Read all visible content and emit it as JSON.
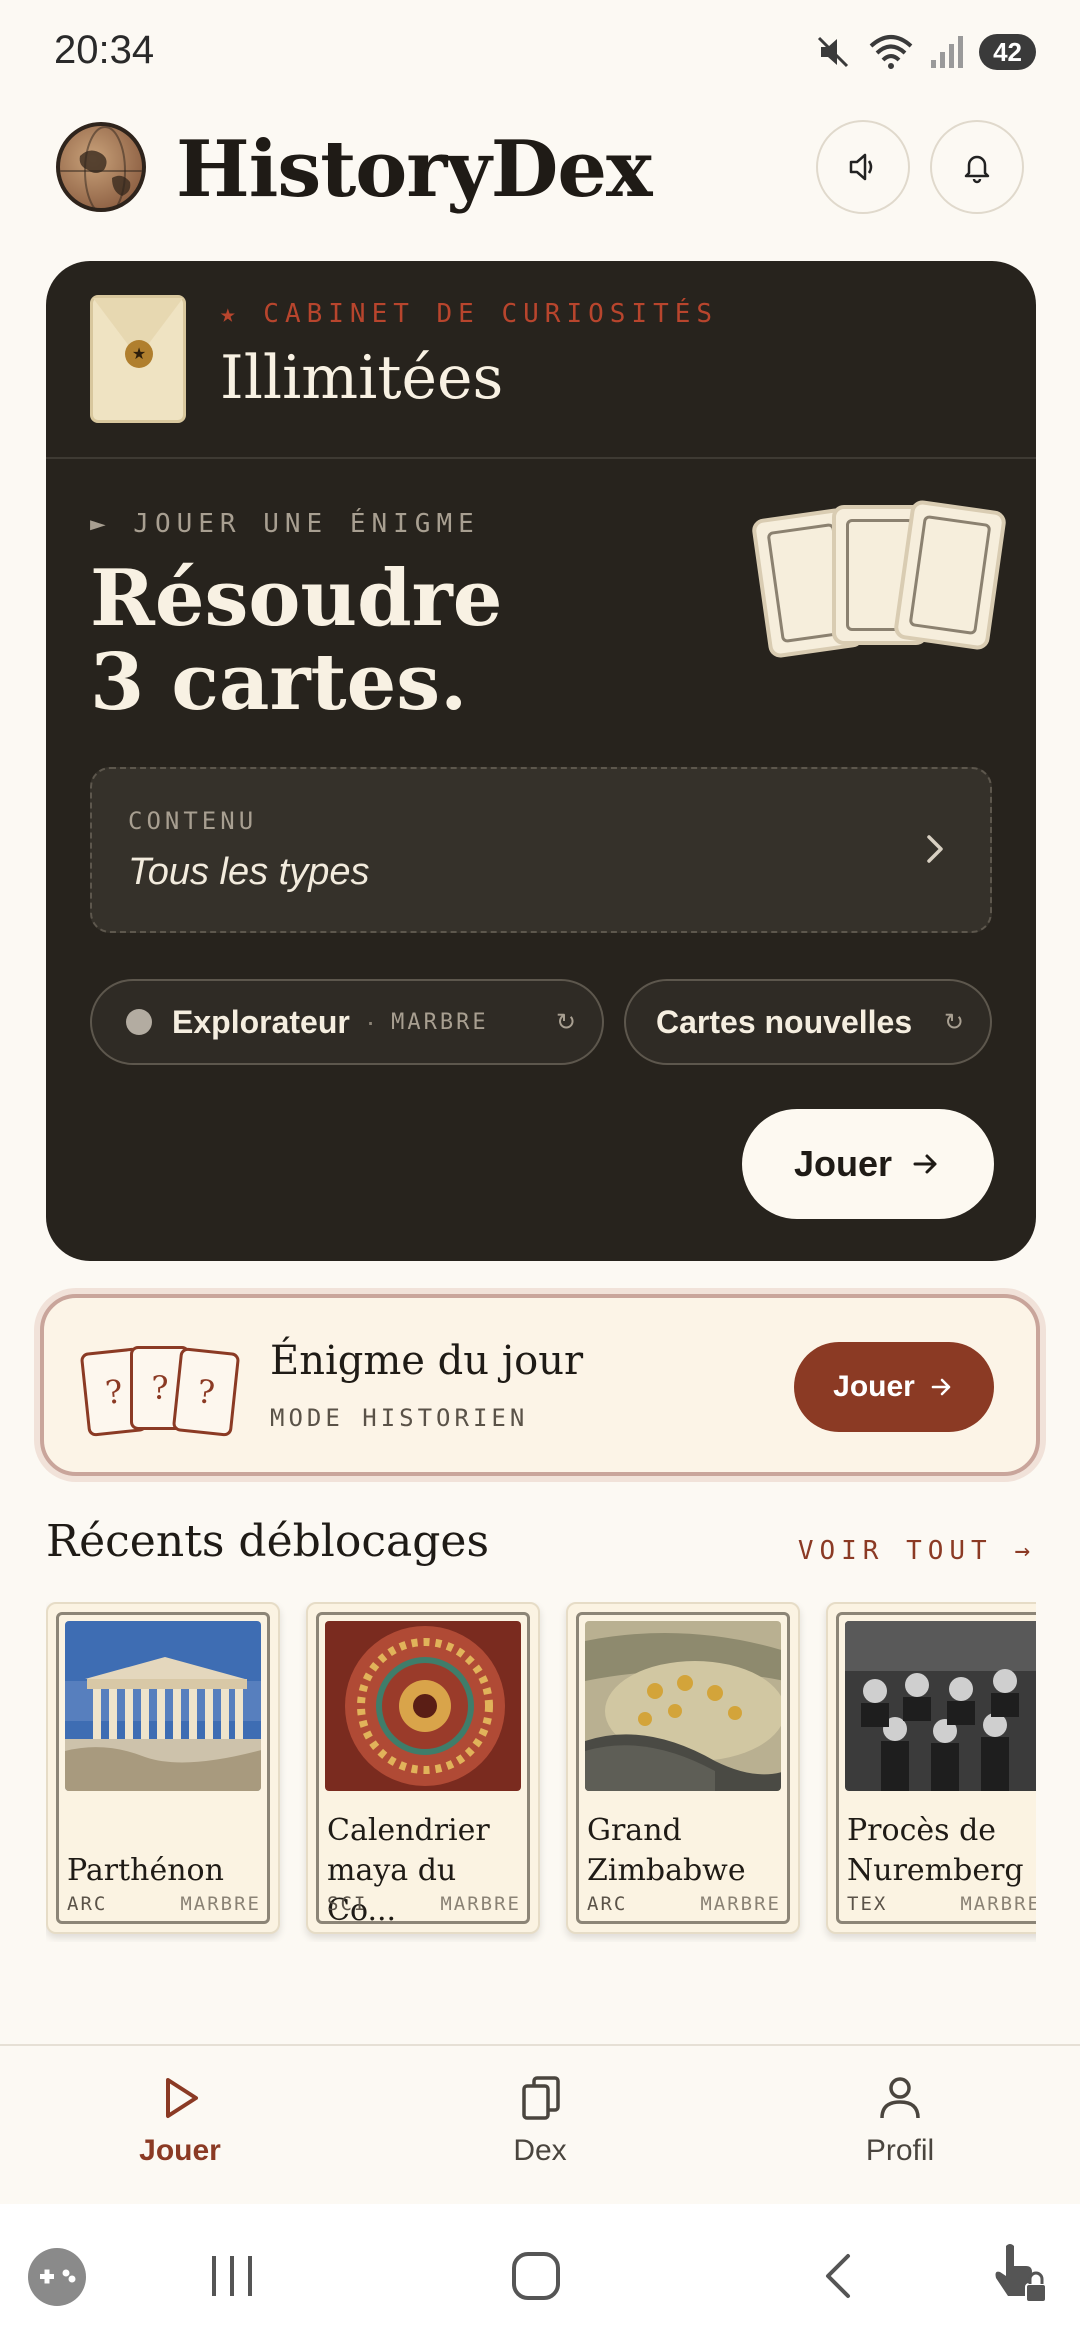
{
  "status_bar": {
    "time": "20:34",
    "battery": "42"
  },
  "header": {
    "title": "HistoryDex"
  },
  "cabinet": {
    "eyebrow": "★ CABINET DE CURIOSITÉS",
    "title": "Illimitées"
  },
  "puzzle": {
    "eyebrow": "► JOUER UNE ÉNIGME",
    "headline_line1": "Résoudre",
    "headline_line2": "3 cartes.",
    "content_label": "CONTENU",
    "content_value": "Tous les types",
    "difficulty_label": "Explorateur",
    "difficulty_sep": "·",
    "difficulty_sub": "MARBRE",
    "cards_label": "Cartes nouvelles",
    "play_label": "Jouer"
  },
  "daily": {
    "title": "Énigme du jour",
    "subtitle": "MODE HISTORIEN",
    "play_label": "Jouer",
    "card_glyph": "?"
  },
  "recents": {
    "title": "Récents déblocages",
    "see_all": "VOIR TOUT →",
    "items": [
      {
        "name": "Parthénon",
        "category": "ARC",
        "rarity": "MARBRE"
      },
      {
        "name": "Calendrier maya du Co...",
        "category": "SCI",
        "rarity": "MARBRE"
      },
      {
        "name": "Grand Zimbabwe",
        "category": "ARC",
        "rarity": "MARBRE"
      },
      {
        "name": "Procès de Nuremberg",
        "category": "TEX",
        "rarity": "MARBRE"
      }
    ]
  },
  "bottom_nav": {
    "items": [
      {
        "label": "Jouer",
        "icon": "play-icon",
        "active": true
      },
      {
        "label": "Dex",
        "icon": "cards-icon",
        "active": false
      },
      {
        "label": "Profil",
        "icon": "person-icon",
        "active": false
      }
    ]
  },
  "colors": {
    "accent": "#8b3a24",
    "dark_card": "#27231d",
    "background": "#fcf9f3"
  }
}
